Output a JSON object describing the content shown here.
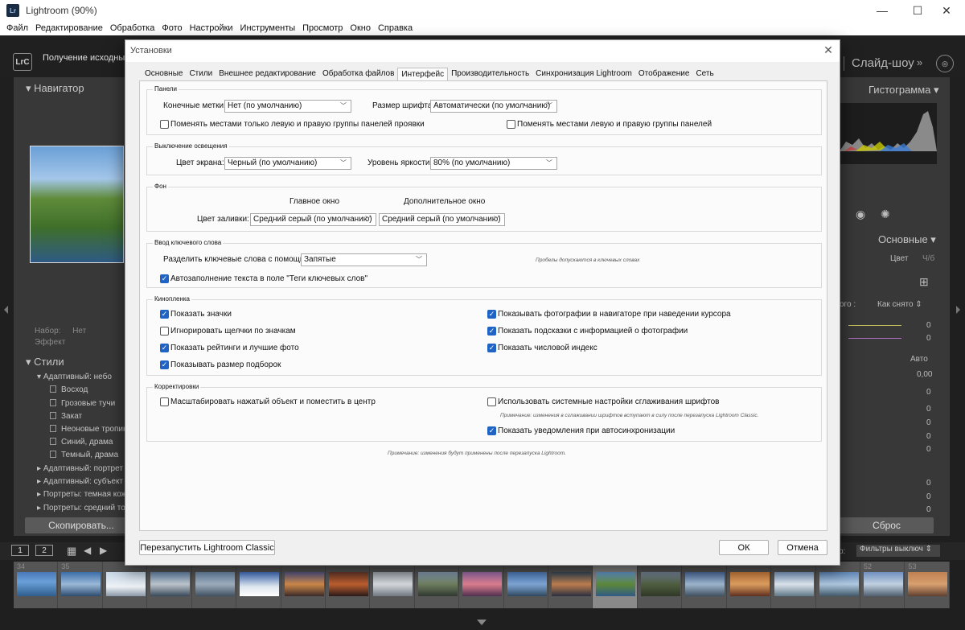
{
  "window": {
    "title": "Lightroom (90%)",
    "minimize": "—",
    "maximize": "☐",
    "close": "✕"
  },
  "menu": [
    "Файл",
    "Редактирование",
    "Обработка",
    "Фото",
    "Настройки",
    "Инструменты",
    "Просмотр",
    "Окно",
    "Справка"
  ],
  "lr": {
    "logo": "LrC",
    "import_status": "Получение исходных п",
    "module": "Слайд-шоу",
    "left": {
      "navigator": "Навигатор",
      "preset_set_label": "Набор:",
      "preset_set_value": "Нет",
      "effect_label": "Эффект",
      "styles": "Стили",
      "adaptive_sky": "Адаптивный: небо",
      "sky_presets": [
        "Восход",
        "Грозовые тучи",
        "Закат",
        "Неоновые тропики",
        "Синий, драма",
        "Темный, драма"
      ],
      "other_groups": [
        "Адаптивный: портрет",
        "Адаптивный: субъект",
        "Портреты: темная кож",
        "Портреты: средний тон"
      ],
      "copy": "Скопировать..."
    },
    "right": {
      "histogram": "Гистограмма",
      "basic": "Основные",
      "color": "Цвет",
      "bw": "Ч/б",
      "wb_value": "Как снято",
      "wb_prefix": "ого :",
      "auto": "Авто",
      "exposure": "0,00",
      "zero": "0",
      "reset": "Сброс"
    },
    "filmstrip": {
      "view1": "1",
      "view2": "2",
      "filter_label": "р:",
      "filter_value": "Фильтры выключ",
      "numbers": [
        "34",
        "35",
        "",
        "",
        "",
        "",
        "",
        "",
        "",
        "",
        "",
        "",
        "",
        "",
        "",
        "",
        "",
        "",
        "",
        "52",
        "53"
      ]
    }
  },
  "dialog": {
    "title": "Установки",
    "tabs": [
      "Основные",
      "Стили",
      "Внешнее редактирование",
      "Обработка файлов",
      "Интерфейс",
      "Производительность",
      "Синхронизация Lightroom",
      "Отображение",
      "Сеть"
    ],
    "active_tab": "Интерфейс",
    "panels": {
      "title": "Панели",
      "end_marks_label": "Конечные метки:",
      "end_marks_value": "Нет (по умолчанию)",
      "font_size_label": "Размер шрифта:",
      "font_size_value": "Автоматически (по умолчанию)",
      "swap_develop": "Поменять местами только левую и правую группы панелей проявки",
      "swap_all": "Поменять местами левую и правую группы панелей"
    },
    "lights_out": {
      "title": "Выключение освещения",
      "screen_color_label": "Цвет экрана:",
      "screen_color_value": "Черный (по умолчанию)",
      "dim_level_label": "Уровень яркости:",
      "dim_level_value": "80% (по умолчанию)"
    },
    "background": {
      "title": "Фон",
      "main_window": "Главное окно",
      "secondary_window": "Дополнительное окно",
      "fill_color_label": "Цвет заливки:",
      "main_value": "Средний серый (по умолчанию)",
      "secondary_value": "Средний серый (по умолчанию)"
    },
    "keywords": {
      "title": "Ввод ключевого слова",
      "separate_label": "Разделить ключевые слова с помощью:",
      "separate_value": "Запятые",
      "spaces_note": "Пробелы допускаются в ключевых словах",
      "autocomplete": "Автозаполнение текста в поле \"Теги ключевых слов\""
    },
    "filmstrip": {
      "title": "Кинопленка",
      "show_badges": "Показать значки",
      "ignore_clicks": "Игнорировать щелчки по значкам",
      "show_ratings": "Показать рейтинги и лучшие фото",
      "show_stack_counts": "Показывать размер подборок",
      "show_in_navigator": "Показывать фотографии в навигаторе при наведении курсора",
      "show_tooltips": "Показать подсказки с информацией о фотографии",
      "show_index": "Показать числовой индекс"
    },
    "tweaks": {
      "title": "Корректировки",
      "zoom_center": "Масштабировать нажатый объект и поместить в центр",
      "system_smoothing": "Использовать системные настройки сглаживания шрифтов",
      "smoothing_note": "Примечание: изменения в сглаживании шрифтов вступают в силу после перезапуска Lightroom Classic.",
      "show_autosync": "Показать уведомления при автосинхронизации"
    },
    "restart_note": "Примечание: изменения будут применены после перезапуска Lightroom.",
    "restart_button": "Перезапустить Lightroom Classic",
    "ok_button": "ОК",
    "cancel_button": "Отмена",
    "close": "✕"
  }
}
